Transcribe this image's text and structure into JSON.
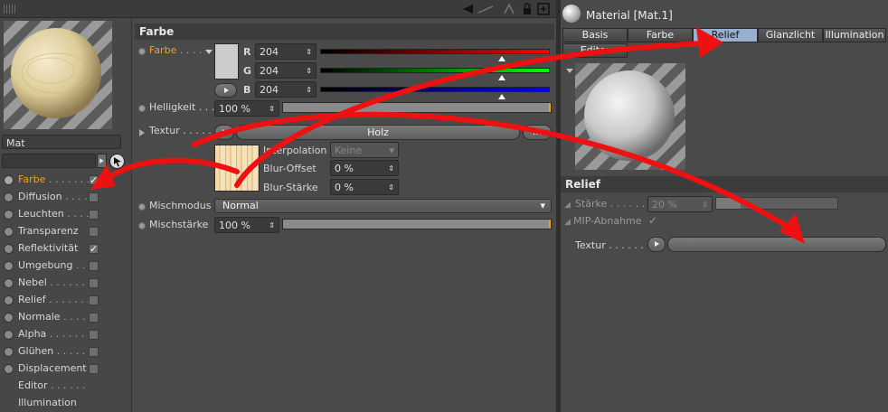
{
  "left": {
    "name_field": "Mat",
    "channels": [
      {
        "label": "Farbe",
        "dots": " . . . . . . .",
        "active": true,
        "checked": true
      },
      {
        "label": "Diffusion",
        "dots": " . . . .",
        "active": false,
        "checked": false
      },
      {
        "label": "Leuchten",
        "dots": " . . . .",
        "active": false,
        "checked": false
      },
      {
        "label": "Transparenz",
        "dots": "",
        "active": false,
        "checked": false
      },
      {
        "label": "Reflektivität",
        "dots": "",
        "active": false,
        "checked": true
      },
      {
        "label": "Umgebung",
        "dots": " . .",
        "active": false,
        "checked": false
      },
      {
        "label": "Nebel",
        "dots": " . . . . . . .",
        "active": false,
        "checked": false
      },
      {
        "label": "Relief",
        "dots": " . . . . . . .",
        "active": false,
        "checked": false
      },
      {
        "label": "Normale",
        "dots": " . . . .",
        "active": false,
        "checked": false
      },
      {
        "label": "Alpha",
        "dots": " . . . . . . .",
        "active": false,
        "checked": false
      },
      {
        "label": "Glühen",
        "dots": " . . . . . .",
        "active": false,
        "checked": false
      },
      {
        "label": "Displacement",
        "dots": "",
        "active": false,
        "checked": false
      },
      {
        "label": "Editor",
        "dots": " . . . . . .",
        "active": null,
        "checked": null
      },
      {
        "label": "Illumination",
        "dots": "",
        "active": null,
        "checked": null
      }
    ]
  },
  "farbe": {
    "header": "Farbe",
    "color_label": "Farbe",
    "color_dots": " . . . .",
    "r_label": "R",
    "r_value": "204",
    "g_label": "G",
    "g_value": "204",
    "b_label": "B",
    "b_value": "204",
    "helligkeit_label": "Helligkeit",
    "helligkeit_dots": " . . .",
    "helligkeit_value": "100 %",
    "helligkeit_fraction": 1.0,
    "textur_label": "Textur",
    "textur_dots": " . . . . .",
    "textur_name": "Holz",
    "more_btn": "...",
    "interpolation_label": "Interpolation",
    "interpolation_value": "Keine",
    "blur_offset_label": "Blur-Offset",
    "blur_offset_value": "0 %",
    "blur_staerke_label": "Blur-Stärke",
    "blur_staerke_value": "0 %",
    "mischmodus_label": "Mischmodus",
    "mischmodus_value": "Normal",
    "mischstaerke_label": "Mischstärke",
    "mischstaerke_value": "100 %",
    "mischstaerke_fraction": 1.0
  },
  "right": {
    "title": "Material [Mat.1]",
    "tabs_row1": [
      "Basis",
      "Farbe",
      "Relief",
      "Glanzlicht",
      "Illumination"
    ],
    "active_tab": "Relief",
    "tabs_row2": [
      "Editor"
    ],
    "relief_header": "Relief",
    "staerke_label": "Stärke",
    "staerke_dots": " . . . . . .",
    "staerke_value": "20 %",
    "staerke_fraction": 0.2,
    "mip_label": "MIP-Abnahme",
    "textur_label": "Textur",
    "textur_dots": " . . . . . ."
  },
  "colors": {
    "accent_orange": "#f0a020",
    "annotation_red": "#ee1111",
    "tab_active": "#9aaecf"
  }
}
